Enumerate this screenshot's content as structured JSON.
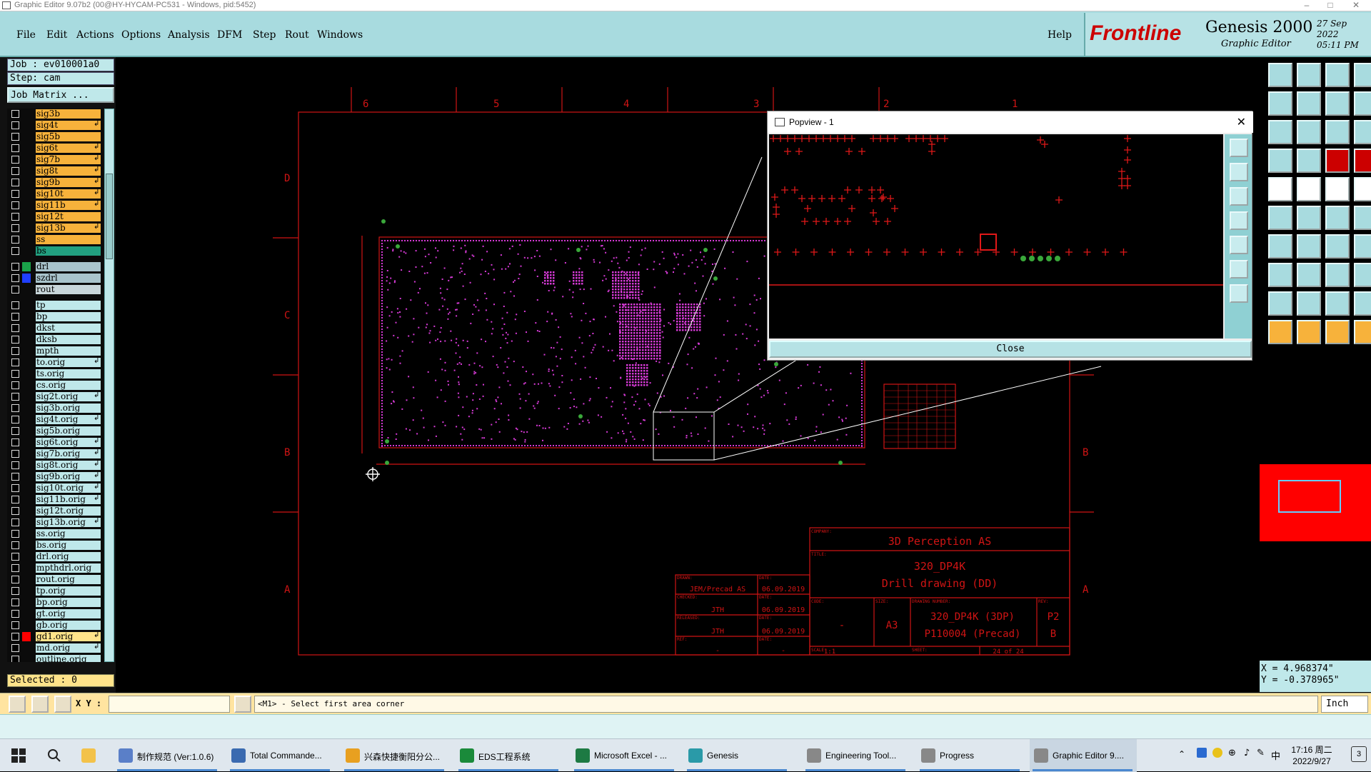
{
  "window": {
    "title": "Graphic Editor 9.07b2 (00@HY-HYCAM-PC531 - Windows, pid:5452)"
  },
  "menu": {
    "items": [
      "File",
      "Edit",
      "Actions",
      "Options",
      "Analysis",
      "DFM",
      "Step",
      "Rout",
      "Windows"
    ],
    "help": "Help"
  },
  "brand": {
    "logo": "Frontline",
    "product": "Genesis 2000",
    "subtitle": "Graphic Editor",
    "date": "27 Sep 2022",
    "time": "05:11 PM"
  },
  "job": {
    "job_label": "Job : ev010001a0",
    "step_label": "Step: cam",
    "matrix_button": "Job Matrix ..."
  },
  "layers": [
    {
      "name": "sig3b",
      "color": "#f7b23b",
      "arrow": false
    },
    {
      "name": "sig4t",
      "color": "#f7b23b",
      "arrow": true
    },
    {
      "name": "sig5b",
      "color": "#f7b23b",
      "arrow": false
    },
    {
      "name": "sig6t",
      "color": "#f7b23b",
      "arrow": true
    },
    {
      "name": "sig7b",
      "color": "#f7b23b",
      "arrow": true
    },
    {
      "name": "sig8t",
      "color": "#f7b23b",
      "arrow": true
    },
    {
      "name": "sig9b",
      "color": "#f7b23b",
      "arrow": true
    },
    {
      "name": "sig10t",
      "color": "#f7b23b",
      "arrow": true
    },
    {
      "name": "sig11b",
      "color": "#f7b23b",
      "arrow": true
    },
    {
      "name": "sig12t",
      "color": "#f7b23b",
      "arrow": false
    },
    {
      "name": "sig13b",
      "color": "#f7b23b",
      "arrow": true
    },
    {
      "name": "ss",
      "color": "#f7b23b",
      "arrow": false
    },
    {
      "name": "bs",
      "color": "#22a080",
      "arrow": false
    },
    {
      "name": "drl",
      "color": "#a9c4cc",
      "arrow": false,
      "swatch": "#1aa34a",
      "gap": true
    },
    {
      "name": "szdrl",
      "color": "#a9c4cc",
      "arrow": false,
      "swatch": "#1f3fff"
    },
    {
      "name": "rout",
      "color": "#c8d6da",
      "arrow": false
    },
    {
      "name": "tp",
      "color": "#bfe8ea",
      "arrow": false,
      "gap": true
    },
    {
      "name": "bp",
      "color": "#bfe8ea",
      "arrow": false
    },
    {
      "name": "dkst",
      "color": "#bfe8ea",
      "arrow": false
    },
    {
      "name": "dksb",
      "color": "#bfe8ea",
      "arrow": false
    },
    {
      "name": "mpth",
      "color": "#bfe8ea",
      "arrow": false
    },
    {
      "name": "to.orig",
      "color": "#bfe8ea",
      "arrow": true
    },
    {
      "name": "ts.orig",
      "color": "#bfe8ea",
      "arrow": false
    },
    {
      "name": "cs.orig",
      "color": "#bfe8ea",
      "arrow": false
    },
    {
      "name": "sig2t.orig",
      "color": "#bfe8ea",
      "arrow": true
    },
    {
      "name": "sig3b.orig",
      "color": "#bfe8ea",
      "arrow": false
    },
    {
      "name": "sig4t.orig",
      "color": "#bfe8ea",
      "arrow": true
    },
    {
      "name": "sig5b.orig",
      "color": "#bfe8ea",
      "arrow": false
    },
    {
      "name": "sig6t.orig",
      "color": "#bfe8ea",
      "arrow": true
    },
    {
      "name": "sig7b.orig",
      "color": "#bfe8ea",
      "arrow": true
    },
    {
      "name": "sig8t.orig",
      "color": "#bfe8ea",
      "arrow": true
    },
    {
      "name": "sig9b.orig",
      "color": "#bfe8ea",
      "arrow": true
    },
    {
      "name": "sig10t.orig",
      "color": "#bfe8ea",
      "arrow": true
    },
    {
      "name": "sig11b.orig",
      "color": "#bfe8ea",
      "arrow": true
    },
    {
      "name": "sig12t.orig",
      "color": "#bfe8ea",
      "arrow": false
    },
    {
      "name": "sig13b.orig",
      "color": "#bfe8ea",
      "arrow": true
    },
    {
      "name": "ss.orig",
      "color": "#bfe8ea",
      "arrow": false
    },
    {
      "name": "bs.orig",
      "color": "#bfe8ea",
      "arrow": false
    },
    {
      "name": "drl.orig",
      "color": "#bfe8ea",
      "arrow": false
    },
    {
      "name": "mpthdrl.orig",
      "color": "#bfe8ea",
      "arrow": false
    },
    {
      "name": "rout.orig",
      "color": "#bfe8ea",
      "arrow": false
    },
    {
      "name": "tp.orig",
      "color": "#bfe8ea",
      "arrow": false
    },
    {
      "name": "bp.orig",
      "color": "#bfe8ea",
      "arrow": false
    },
    {
      "name": "gt.orig",
      "color": "#bfe8ea",
      "arrow": false
    },
    {
      "name": "gb.orig",
      "color": "#bfe8ea",
      "arrow": false
    },
    {
      "name": "gd1.orig",
      "color": "#ffe38a",
      "arrow": true,
      "swatch": "#ff0000"
    },
    {
      "name": "md.orig",
      "color": "#bfe8ea",
      "arrow": true
    },
    {
      "name": "outline.orig",
      "color": "#bfe8ea",
      "arrow": false
    }
  ],
  "selected_label": "Selected : 0",
  "drawing": {
    "frame_cols": [
      "6",
      "5",
      "4",
      "3",
      "2",
      "1"
    ],
    "frame_rows": [
      "D",
      "C",
      "B",
      "A"
    ],
    "company_label": "COMPANY:",
    "company": "3D Perception AS",
    "title_label": "TITLE:",
    "title_line1": "320_DP4K",
    "title_line2": "Drill drawing (DD)",
    "code_label": "CODE:",
    "code": "-",
    "size_label": "SIZE:",
    "size": "A3",
    "drawing_number_label": "DRAWING NUMBER:",
    "drawing_number_1": "320_DP4K (3DP)",
    "drawing_number_2": "P110004 (Precad)",
    "rev_label": "REV:",
    "rev_1": "P2",
    "rev_2": "B",
    "scale_label": "SCALE:",
    "scale": "1:1",
    "sheet_label": "SHEET:",
    "sheet": "24 of 24",
    "drawn_label": "DRAWN:",
    "drawn": "JEM/Precad AS",
    "checked_label": "CHECKED:",
    "checked": "JTH",
    "released_label": "RELEASED:",
    "released": "JTH",
    "ref_label": "REF:",
    "ref": "-",
    "date_label": "DATE:",
    "date_1": "06.09.2019",
    "date_2": "06.09.2019",
    "date_3": "06.09.2019",
    "date_4": "-"
  },
  "popview": {
    "title": "Popview - 1",
    "close_label": "Close"
  },
  "coords": {
    "x": "X = 4.968374\"",
    "y": "Y = -0.378965\""
  },
  "status": {
    "xy_label": "X Y :",
    "input_value": "",
    "message": "<M1> - Select first area corner",
    "units": "Inch"
  },
  "taskbar": {
    "items": [
      {
        "label": "制作规范 (Ver:1.0.6)",
        "color": "#5a7fc8"
      },
      {
        "label": "Total Commande...",
        "color": "#3a6ab0"
      },
      {
        "label": "兴森快捷衡阳分公...",
        "color": "#e8a020"
      },
      {
        "label": "EDS工程系统",
        "color": "#1a8a3a"
      },
      {
        "label": "Microsoft Excel - ...",
        "color": "#1d7a43"
      },
      {
        "label": "Genesis",
        "color": "#2a9aa8"
      },
      {
        "label": "Engineering Tool...",
        "color": "#888"
      },
      {
        "label": "Progress",
        "color": "#888"
      },
      {
        "label": "Graphic Editor 9....",
        "color": "#888"
      }
    ],
    "clock_time": "17:16 周二",
    "clock_date": "2022/9/27",
    "ime": "中",
    "notifications": "3"
  },
  "colors": {
    "menu_bg": "#a8dbdf",
    "drawing_red": "#e01818",
    "pads_magenta": "#d63ad6",
    "status_bg": "#ffe4a0"
  }
}
